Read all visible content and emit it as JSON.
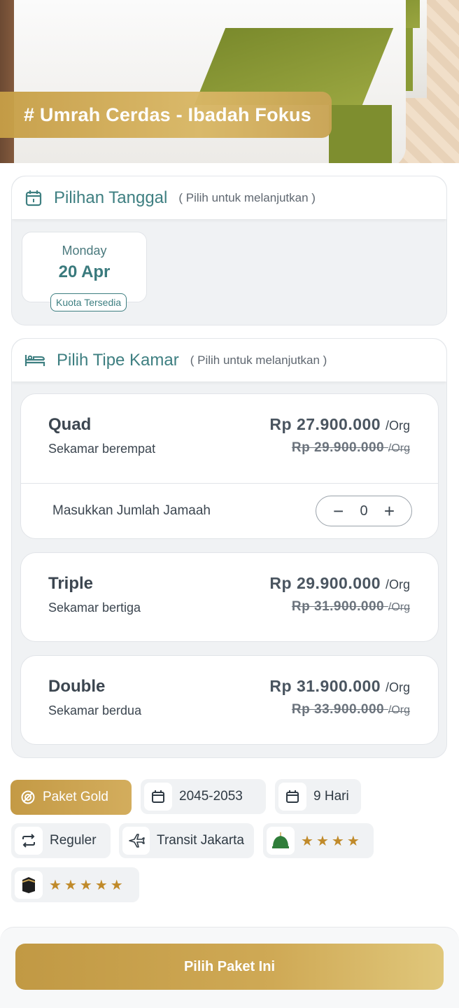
{
  "hero": {
    "title": "# Umrah Cerdas - Ibadah Fokus"
  },
  "date_section": {
    "title": "Pilihan Tanggal",
    "hint": "( Pilih untuk melanjutkan )",
    "dates": [
      {
        "day": "Monday",
        "date": "20 Apr",
        "quota": "Kuota Tersedia"
      }
    ]
  },
  "room_section": {
    "title": "Pilih Tipe Kamar",
    "hint": "( Pilih untuk melanjutkan )",
    "rooms": [
      {
        "name": "Quad",
        "desc": "Sekamar berempat",
        "price": "Rp  27.900.000",
        "old_price": "Rp  29.900.000",
        "unit": "/Org"
      },
      {
        "name": "Triple",
        "desc": "Sekamar bertiga",
        "price": "Rp  29.900.000",
        "old_price": "Rp  31.900.000",
        "unit": "/Org"
      },
      {
        "name": "Double",
        "desc": "Sekamar berdua",
        "price": "Rp  31.900.000",
        "old_price": "Rp  33.900.000",
        "unit": "/Org"
      }
    ],
    "quantity_label": "Masukkan Jumlah Jamaah",
    "quantity_value": "0",
    "minus": "−",
    "plus": "+"
  },
  "tags": {
    "package": "Paket Gold",
    "years": "2045-2053",
    "duration": "9 Hari",
    "type": "Reguler",
    "transit": "Transit Jakarta",
    "madinah_hotel_stars": 4,
    "makkah_hotel_stars": 5
  },
  "cta": {
    "label": "Pilih Paket Ini"
  },
  "colors": {
    "gold": "#c9a454",
    "teal": "#3e7f81",
    "star": "#c08a2a"
  }
}
